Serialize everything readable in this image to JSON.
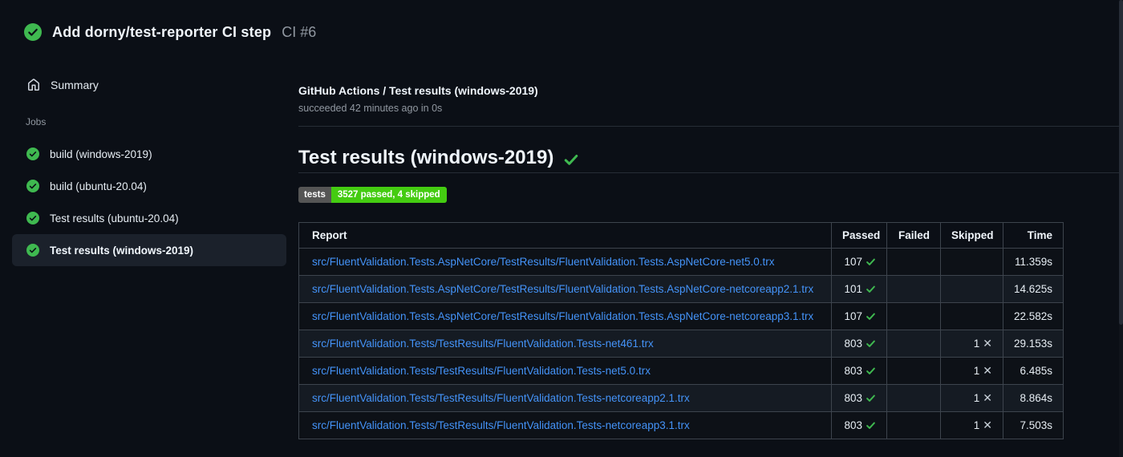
{
  "header": {
    "title": "Add dorny/test-reporter CI step",
    "run_number": "CI #6"
  },
  "sidebar": {
    "summary_label": "Summary",
    "jobs_label": "Jobs",
    "jobs": [
      {
        "label": "build (windows-2019)"
      },
      {
        "label": "build (ubuntu-20.04)"
      },
      {
        "label": "Test results (ubuntu-20.04)"
      },
      {
        "label": "Test results (windows-2019)",
        "selected": true
      }
    ]
  },
  "main": {
    "run_title": "GitHub Actions / Test results (windows-2019)",
    "run_status": "succeeded 42 minutes ago in 0s",
    "section_title": "Test results (windows-2019)",
    "badge": {
      "label": "tests",
      "value": "3527 passed, 4 skipped",
      "label_bg": "#555555",
      "value_bg": "#44cc11"
    },
    "table": {
      "columns": [
        "Report",
        "Passed",
        "Failed",
        "Skipped",
        "Time"
      ],
      "rows": [
        {
          "report": "src/FluentValidation.Tests.AspNetCore/TestResults/FluentValidation.Tests.AspNetCore-net5.0.trx",
          "passed": "107",
          "failed": "",
          "skipped": "",
          "time": "11.359s"
        },
        {
          "report": "src/FluentValidation.Tests.AspNetCore/TestResults/FluentValidation.Tests.AspNetCore-netcoreapp2.1.trx",
          "passed": "101",
          "failed": "",
          "skipped": "",
          "time": "14.625s"
        },
        {
          "report": "src/FluentValidation.Tests.AspNetCore/TestResults/FluentValidation.Tests.AspNetCore-netcoreapp3.1.trx",
          "passed": "107",
          "failed": "",
          "skipped": "",
          "time": "22.582s"
        },
        {
          "report": "src/FluentValidation.Tests/TestResults/FluentValidation.Tests-net461.trx",
          "passed": "803",
          "failed": "",
          "skipped": "1",
          "time": "29.153s"
        },
        {
          "report": "src/FluentValidation.Tests/TestResults/FluentValidation.Tests-net5.0.trx",
          "passed": "803",
          "failed": "",
          "skipped": "1",
          "time": "6.485s"
        },
        {
          "report": "src/FluentValidation.Tests/TestResults/FluentValidation.Tests-netcoreapp2.1.trx",
          "passed": "803",
          "failed": "",
          "skipped": "1",
          "time": "8.864s"
        },
        {
          "report": "src/FluentValidation.Tests/TestResults/FluentValidation.Tests-netcoreapp3.1.trx",
          "passed": "803",
          "failed": "",
          "skipped": "1",
          "time": "7.503s"
        }
      ]
    }
  },
  "colors": {
    "success_green": "#3fb950",
    "link_blue": "#4493f8",
    "page_background": "#0b0f16",
    "selected_item_background": "#1b212b",
    "table_border": "#3d444d"
  }
}
